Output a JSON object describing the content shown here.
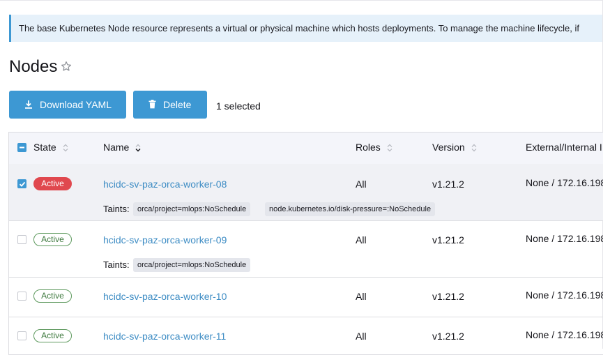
{
  "banner": {
    "text": "The base Kubernetes Node resource represents a virtual or physical machine which hosts deployments. To manage the machine lifecycle, if"
  },
  "page": {
    "title": "Nodes"
  },
  "toolbar": {
    "download_label": "Download YAML",
    "delete_label": "Delete",
    "selected_count": "1 selected"
  },
  "table": {
    "columns": {
      "state": "State",
      "name": "Name",
      "roles": "Roles",
      "version": "Version",
      "ip": "External/Internal I"
    },
    "taints_label": "Taints:",
    "rows": [
      {
        "selected": true,
        "state": "Active",
        "name": "hcidc-sv-paz-orca-worker-08",
        "roles": "All",
        "version": "v1.21.2",
        "ip": "None / 172.16.198",
        "taints": [
          "orca/project=mlops:NoSchedule",
          "node.kubernetes.io/disk-pressure=:NoSchedule"
        ]
      },
      {
        "selected": false,
        "state": "Active",
        "name": "hcidc-sv-paz-orca-worker-09",
        "roles": "All",
        "version": "v1.21.2",
        "ip": "None / 172.16.198",
        "taints": [
          "orca/project=mlops:NoSchedule"
        ]
      },
      {
        "selected": false,
        "state": "Active",
        "name": "hcidc-sv-paz-orca-worker-10",
        "roles": "All",
        "version": "v1.21.2",
        "ip": "None / 172.16.198"
      },
      {
        "selected": false,
        "state": "Active",
        "name": "hcidc-sv-paz-orca-worker-11",
        "roles": "All",
        "version": "v1.21.2",
        "ip": "None / 172.16.198"
      }
    ]
  }
}
